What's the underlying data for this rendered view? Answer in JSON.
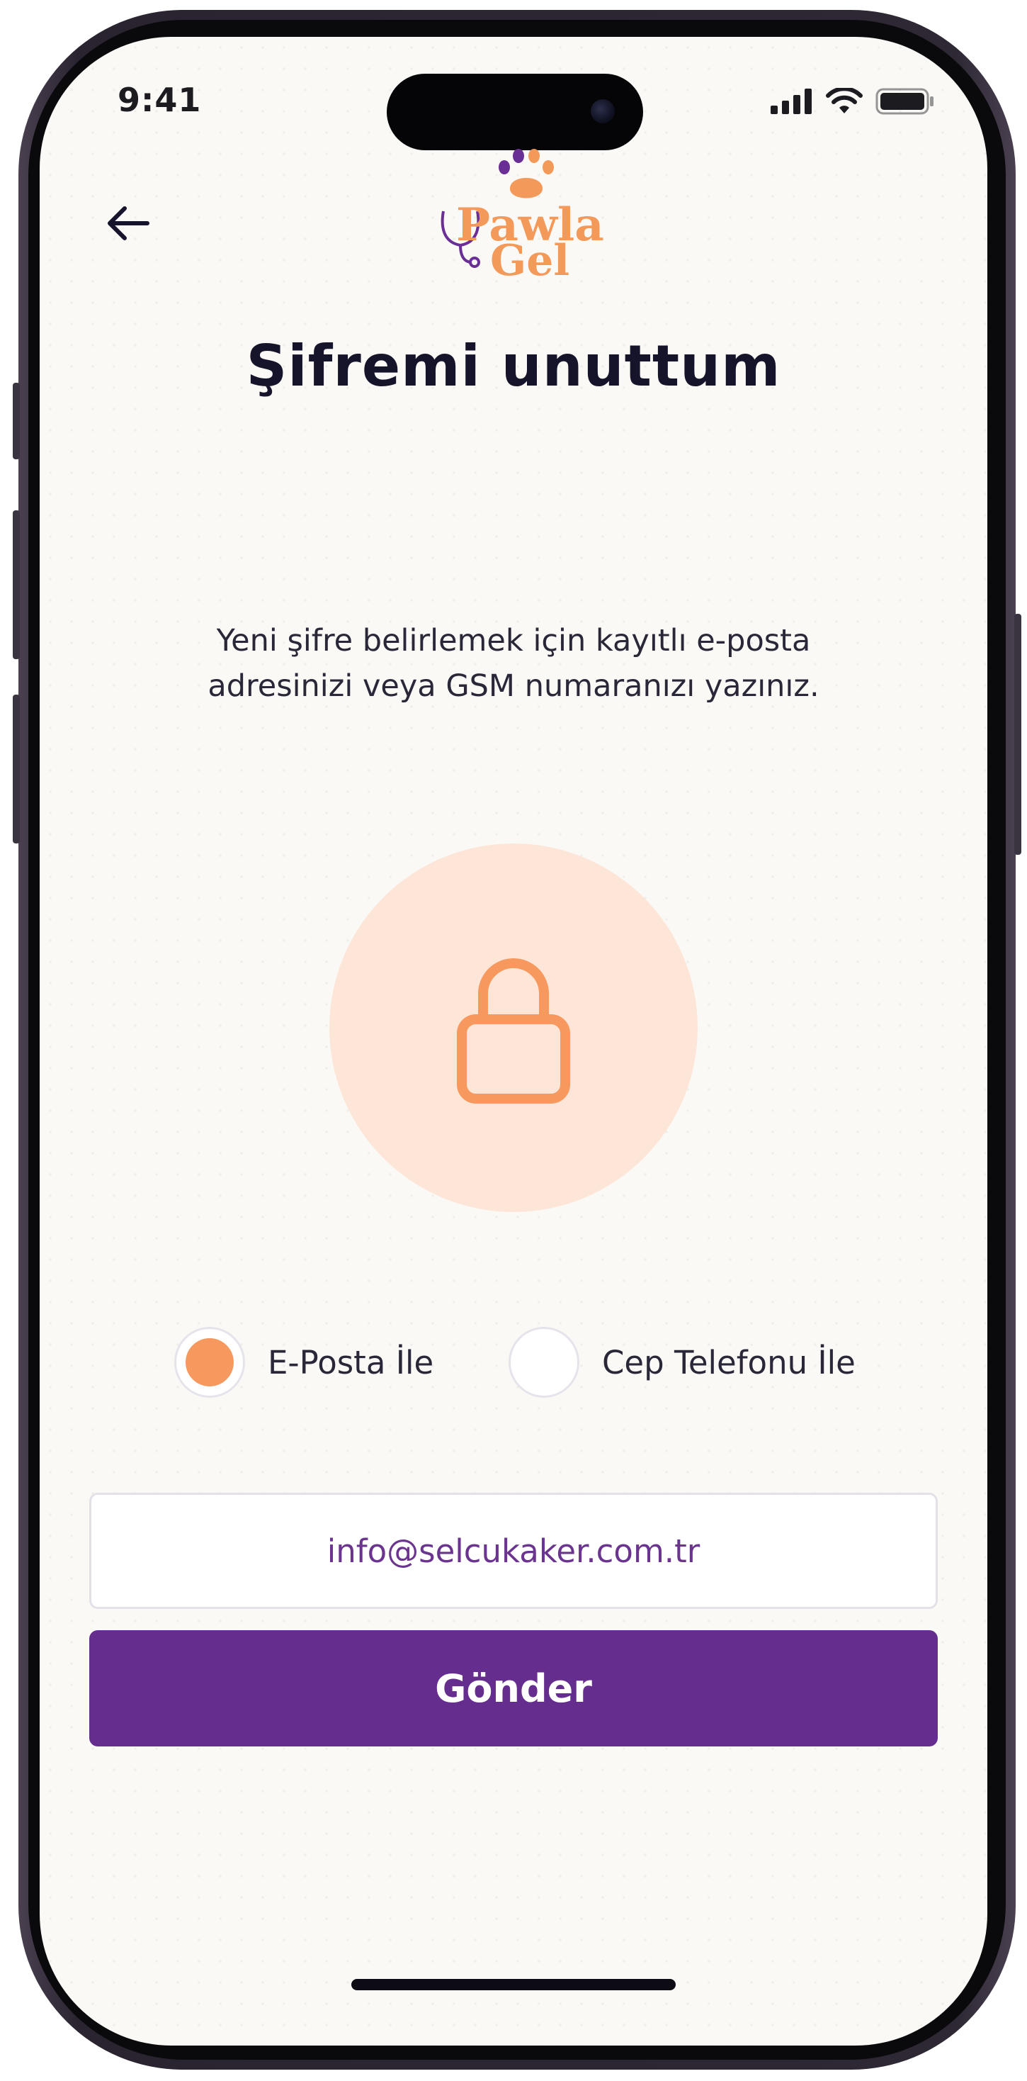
{
  "status_bar": {
    "time": "9:41",
    "signal_icon": "cellular-signal-icon",
    "wifi_icon": "wifi-icon",
    "battery_icon": "battery-icon"
  },
  "header": {
    "back_icon": "arrow-left-icon",
    "logo": {
      "line1": "Pawla",
      "line2": "Gel",
      "icon": "paw-icon"
    }
  },
  "page": {
    "title": "Şifremi unuttum",
    "description": "Yeni şifre belirlemek için kayıtlı e-posta adresinizi veya GSM numaranızı yazınız.",
    "illustration_icon": "lock-icon"
  },
  "method": {
    "options": [
      {
        "label": "E-Posta İle",
        "selected": true
      },
      {
        "label": "Cep Telefonu İle",
        "selected": false
      }
    ]
  },
  "form": {
    "contact_value": "info@selcukaker.com.tr",
    "submit_label": "Gönder"
  },
  "colors": {
    "accent_orange": "#f7995f",
    "brand_purple": "#652d8e",
    "lock_bg": "#fde6d8",
    "screen_bg": "#fbf9f6"
  }
}
